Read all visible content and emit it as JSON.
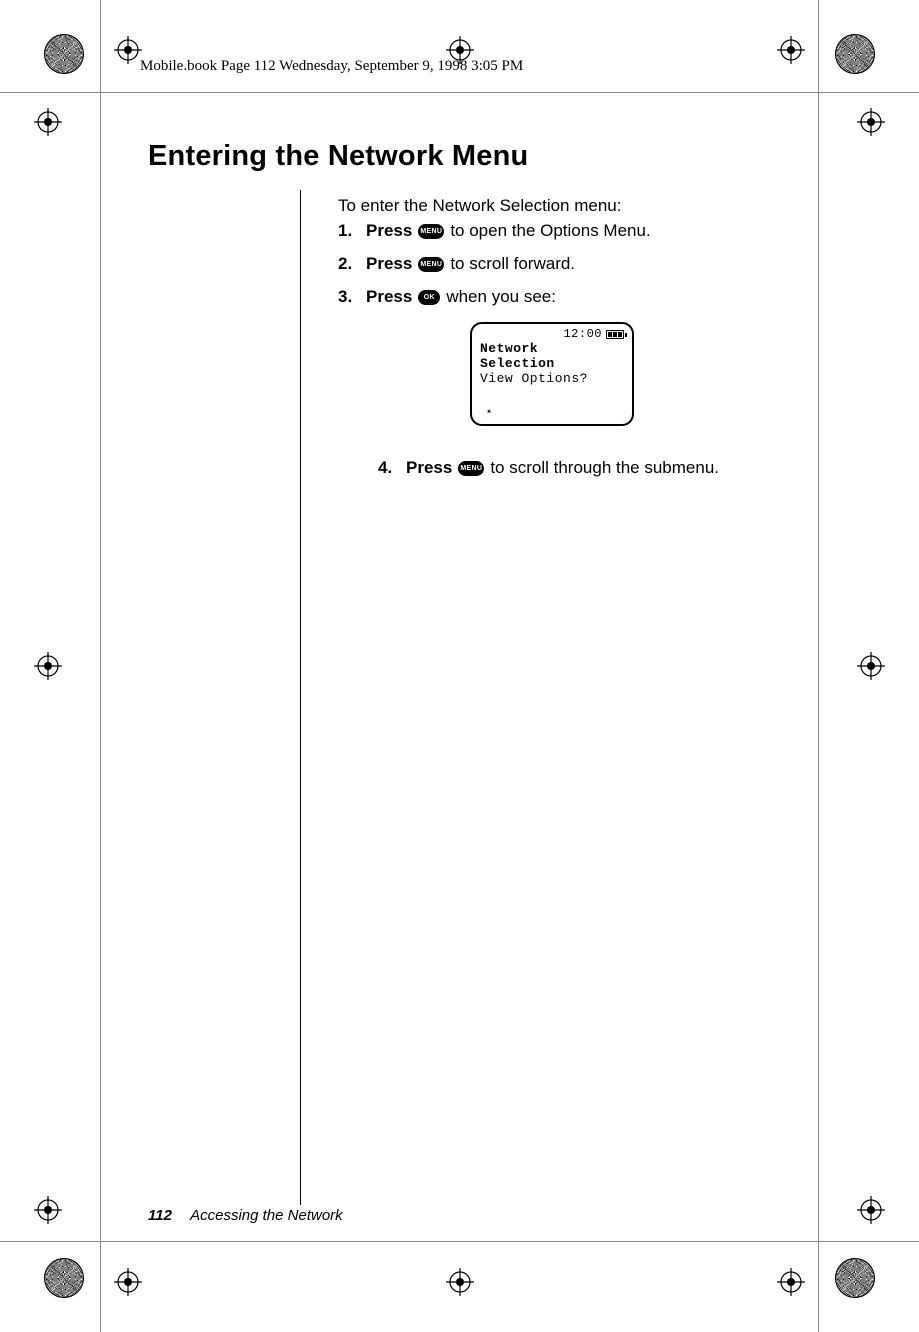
{
  "header_line": "Mobile.book  Page 112  Wednesday, September 9, 1998  3:05 PM",
  "heading": "Entering the Network Menu",
  "intro": "To enter the Network Selection menu:",
  "steps": [
    {
      "n": "1.",
      "press": "Press",
      "key": "MENU",
      "tail": " to open the Options Menu."
    },
    {
      "n": "2.",
      "press": "Press",
      "key": "MENU",
      "tail": " to scroll forward."
    },
    {
      "n": "3.",
      "press": "Press",
      "key": "OK",
      "tail": " when you see:"
    }
  ],
  "screen": {
    "time": "12:00",
    "line1": "Network",
    "line2": "Selection",
    "line3": "View Options?"
  },
  "step4": {
    "n": "4.",
    "press": "Press",
    "key": "MENU",
    "tail": " to scroll through the submenu."
  },
  "footer": {
    "page": "112",
    "chapter": "Accessing the Network"
  }
}
